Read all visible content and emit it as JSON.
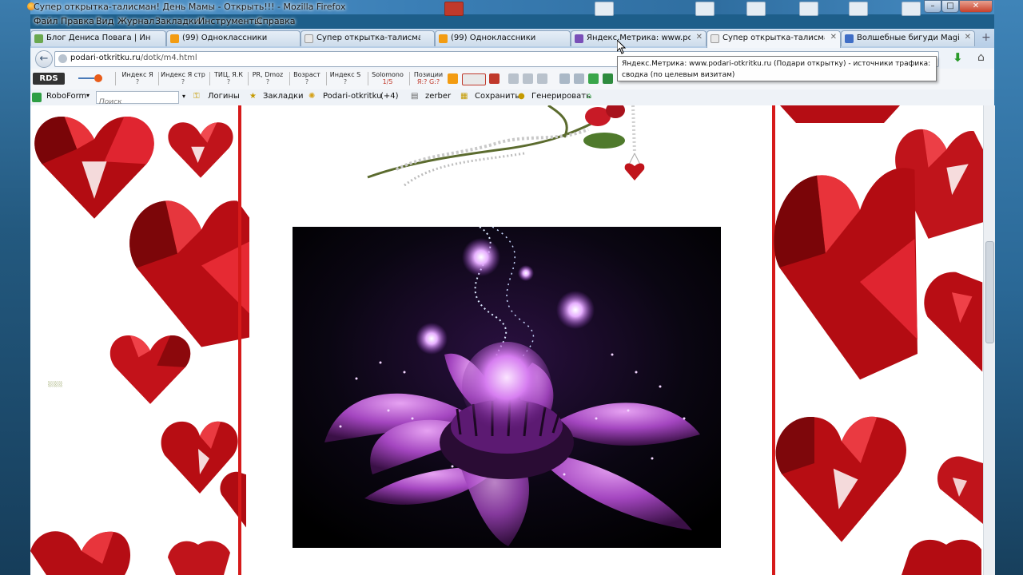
{
  "window": {
    "title": "Супер открытка-талисман! День Мамы - Открыть!!! - Mozilla Firefox",
    "min_label": "–",
    "max_label": "□",
    "close_label": "✕"
  },
  "menu": [
    "Файл",
    "Правка",
    "Вид",
    "Журнал",
    "Закладки",
    "Инструменты",
    "Справка"
  ],
  "tabs": [
    {
      "label": "Блог Дениса Повага | Инте...",
      "fav": "#6aa84f",
      "active": false
    },
    {
      "label": "(99) Одноклассники",
      "fav": "#f39c12",
      "active": false
    },
    {
      "label": "Супер открытка-талисман!...",
      "fav": "#dcdcdc",
      "active": false
    },
    {
      "label": "(99) Одноклассники",
      "fav": "#f39c12",
      "active": false
    },
    {
      "label": "Яндекс.Метрика: www.pod...",
      "fav": "#7a4fb8",
      "active": false
    },
    {
      "label": "Супер открытка-талисман!...",
      "fav": "#dcdcdc",
      "active": true
    },
    {
      "label": "Волшебные бигуди Magic ...",
      "fav": "#3f6ec6",
      "active": false
    }
  ],
  "new_tab": "+",
  "nav": {
    "url_host": "podari-otkritku.ru",
    "url_path": "/dotk/m4.html",
    "back_label": "←"
  },
  "seo": {
    "rds": "RDS",
    "items": [
      {
        "label": "Индекс Я",
        "value": "?"
      },
      {
        "label": "Индекс Я стр",
        "value": "?"
      },
      {
        "label": "ТИЦ, Я.К",
        "value": "?"
      },
      {
        "label": "PR, Dmoz",
        "value": "?"
      },
      {
        "label": "Возраст",
        "value": "?"
      },
      {
        "label": "Индекс S",
        "value": "?"
      },
      {
        "label": "Solomono",
        "value": "1/5"
      },
      {
        "label": "Позиции",
        "value": "Я:? G:?"
      }
    ]
  },
  "bookmarks": {
    "roboform": "RoboForm",
    "search_placeholder": "Поиск",
    "logins": "Логины",
    "zakladki": "Закладки",
    "podari": "Podari-otkritku",
    "podari_count": "(+4)",
    "zerber": "zerber",
    "save": "Сохранить",
    "generate": "Генерировать"
  },
  "tooltip": {
    "line1": "Яндекс.Метрика: www.podari-otkritku.ru (Подари открытку) - источники трафика:",
    "line2": "сводка (по целевым визитам)"
  },
  "colors": {
    "accent_red": "#d61a1a",
    "flower_purple": "#b25ad8"
  }
}
